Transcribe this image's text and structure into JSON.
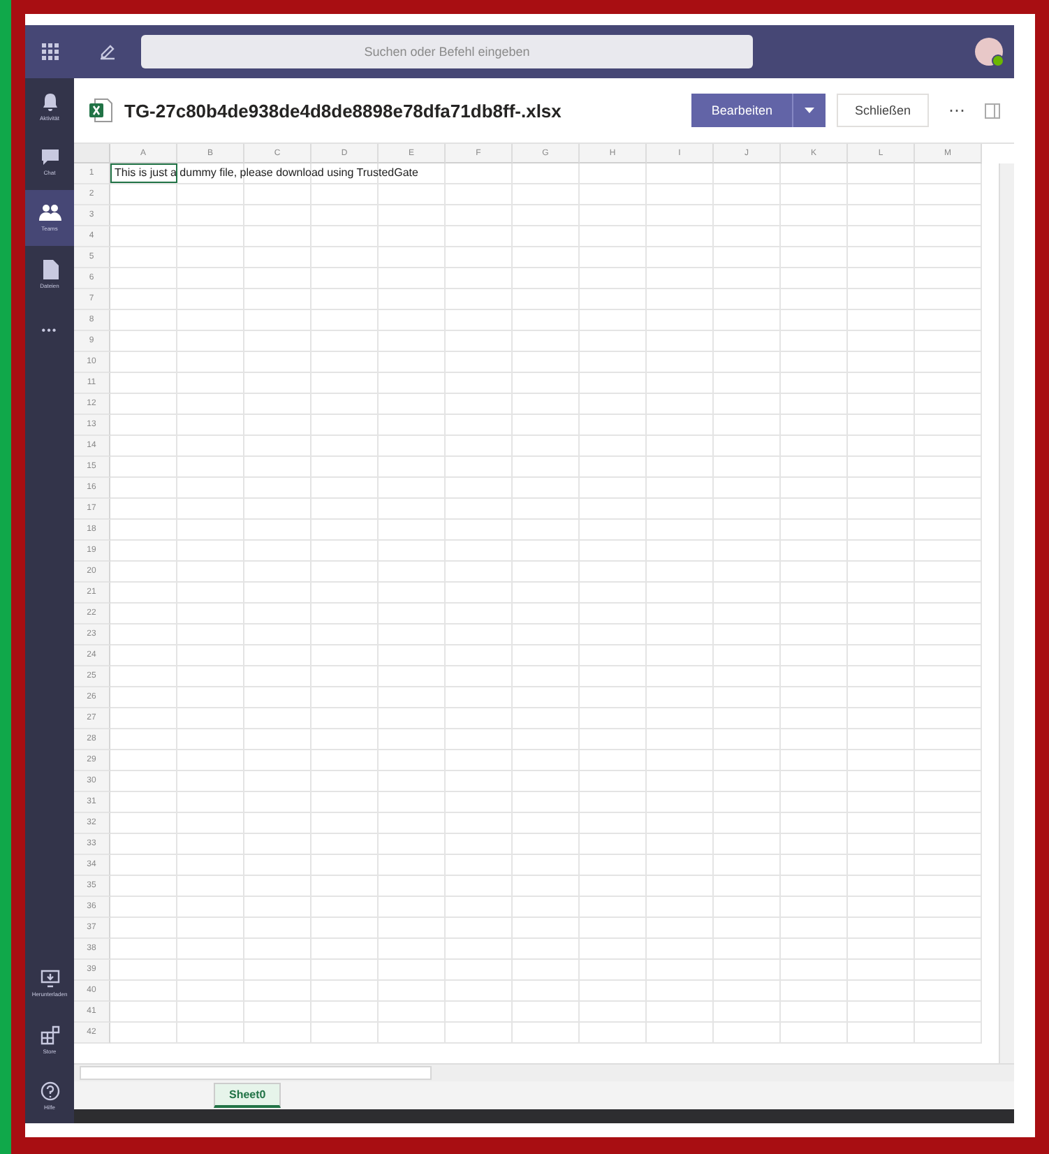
{
  "top_bar": {
    "search": {
      "placeholder": "Suchen oder Befehl eingeben"
    }
  },
  "sidebar": {
    "items": [
      {
        "kind": "bell",
        "label": "Aktivität",
        "selected": false
      },
      {
        "kind": "chat",
        "label": "Chat",
        "selected": false
      },
      {
        "kind": "people",
        "label": "Teams",
        "selected": true
      },
      {
        "kind": "file",
        "label": "Dateien",
        "selected": false
      },
      {
        "kind": "more",
        "label": "•••",
        "selected": false
      }
    ],
    "bottom_items": [
      {
        "kind": "download",
        "label": "Herunterladen",
        "selected": false
      },
      {
        "kind": "apps",
        "label": "Store",
        "selected": false
      },
      {
        "kind": "help",
        "label": "Hilfe",
        "selected": false
      }
    ]
  },
  "file": {
    "title": "TG-27c80b4de938de4d8de8898e78dfa71db8ff-.xlsx",
    "buttons": [
      {
        "kind": "primary",
        "label": "Bearbeiten"
      },
      {
        "kind": "secondary",
        "label": "Schließen"
      },
      {
        "kind": "more",
        "label": "⋯"
      }
    ]
  },
  "sheet": {
    "columns": [
      "A",
      "B",
      "C",
      "D",
      "E",
      "F",
      "G",
      "H",
      "I",
      "J",
      "K",
      "L",
      "M"
    ],
    "rows": [
      "1",
      "2",
      "3",
      "4",
      "5",
      "6",
      "7",
      "8",
      "9",
      "10",
      "11",
      "12",
      "13",
      "14",
      "15",
      "16",
      "17",
      "18",
      "19",
      "20",
      "21",
      "22",
      "23",
      "24",
      "25",
      "26",
      "27",
      "28",
      "29",
      "30",
      "31",
      "32",
      "33",
      "34",
      "35",
      "36",
      "37",
      "38",
      "39",
      "40",
      "41",
      "42"
    ],
    "cell_a1": {
      "text": "This is just a dummy file, please download using TrustedGate",
      "selected": true
    },
    "tabs": [
      {
        "label": "Sheet0",
        "selected": true
      }
    ]
  }
}
